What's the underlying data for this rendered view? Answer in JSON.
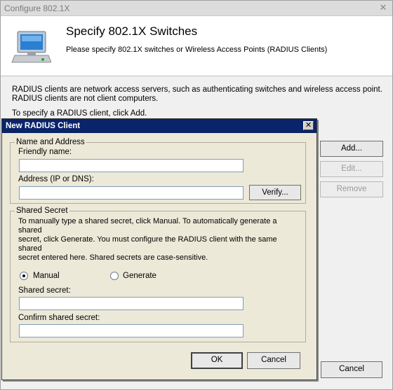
{
  "outer": {
    "title": "Configure 802.1X",
    "banner_title": "Specify 802.1X Switches",
    "banner_subtitle": "Please specify 802.1X switches or Wireless Access Points (RADIUS Clients)",
    "description_line1": "RADIUS clients are network access servers, such as authenticating switches and wireless access point.",
    "description_line2": "RADIUS clients are not client computers.",
    "hint": "To specify a RADIUS client, click Add.",
    "buttons": {
      "add": "Add...",
      "edit": "Edit...",
      "remove": "Remove",
      "cancel": "Cancel"
    },
    "icon": "network-computer-icon"
  },
  "dialog": {
    "title": "New RADIUS Client",
    "close_glyph": "✕",
    "name_group": {
      "legend": "Name and Address",
      "friendly_label": "Friendly name:",
      "friendly_value": "",
      "address_label": "Address (IP or DNS):",
      "address_value": "",
      "verify_button": "Verify..."
    },
    "secret_group": {
      "legend": "Shared Secret",
      "line1": "To manually type a shared secret, click Manual. To automatically generate a shared",
      "line2": "secret, click Generate. You must configure the RADIUS client with the same shared",
      "line3": "secret entered here. Shared secrets are case-sensitive.",
      "manual_label": "Manual",
      "generate_label": "Generate",
      "selected": "manual",
      "secret_label": "Shared secret:",
      "secret_value": "",
      "confirm_label": "Confirm shared secret:",
      "confirm_value": ""
    },
    "buttons": {
      "ok": "OK",
      "cancel": "Cancel"
    }
  }
}
